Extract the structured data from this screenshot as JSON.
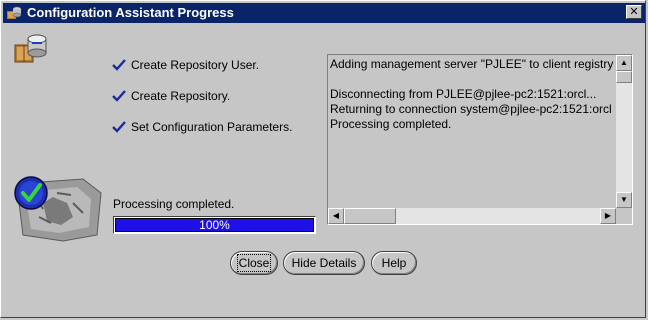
{
  "window": {
    "title": "Configuration Assistant Progress",
    "close_glyph": "✕"
  },
  "icons": {
    "app": "oracle-config-icon",
    "tool": "database-tool-icon",
    "status": "success-check-icon",
    "check": "checkmark-icon"
  },
  "steps": [
    {
      "label": "Create Repository User.",
      "done": true
    },
    {
      "label": "Create Repository.",
      "done": true
    },
    {
      "label": "Set Configuration Parameters.",
      "done": true
    }
  ],
  "status": {
    "label": "Processing completed.",
    "progress_fraction": 1.0,
    "progress_text": "100%"
  },
  "log": {
    "lines": [
      "Adding management server \"PJLEE\" to client registry",
      "",
      "Disconnecting from PJLEE@pjlee-pc2:1521:orcl...",
      "Returning to connection system@pjlee-pc2:1521:orcl",
      "Processing completed."
    ]
  },
  "buttons": {
    "close": "Close",
    "hide_details": "Hide Details",
    "help": "Help"
  },
  "colors": {
    "title_bar": "#0a246a",
    "progress_fill": "#1e10e6",
    "check": "#1a2b9c"
  }
}
